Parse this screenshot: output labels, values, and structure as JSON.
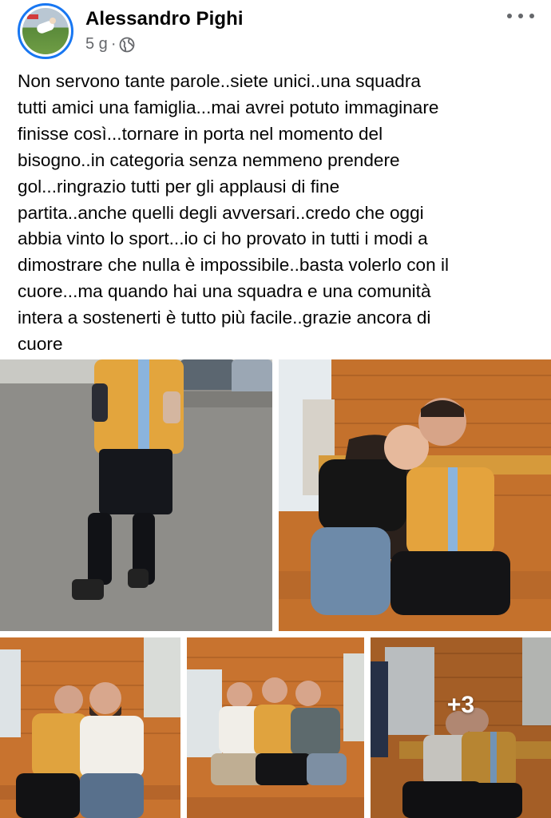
{
  "post": {
    "author": "Alessandro Pighi",
    "time": "5 g",
    "separator": "·",
    "privacy_icon": "globe-icon",
    "more_icon": "more-options-icon",
    "text": "Non servono tante parole..siete unici..una squadra\ntutti amici una famiglia...mai avrei potuto immaginare\nfinisse così...tornare in porta nel momento del\nbisogno..in categoria senza nemmeno prendere\ngol...ringrazio tutti per gli applausi di fine\npartita..anche quelli  degli avversari..credo che oggi\nabbia vinto lo sport...io ci ho provato in tutti i modi a\ndimostrare che nulla è impossibile..basta volerlo con il\ncuore...ma quando hai una squadra e una comunità\nintera a sostenerti è tutto più facile..grazie ancora di\ncuore"
  },
  "photos": {
    "more_count": "+3"
  },
  "colors": {
    "accent": "#1877f2",
    "secondary_text": "#65676b",
    "wood": "#c9742f",
    "jersey": "#e6a93f"
  }
}
